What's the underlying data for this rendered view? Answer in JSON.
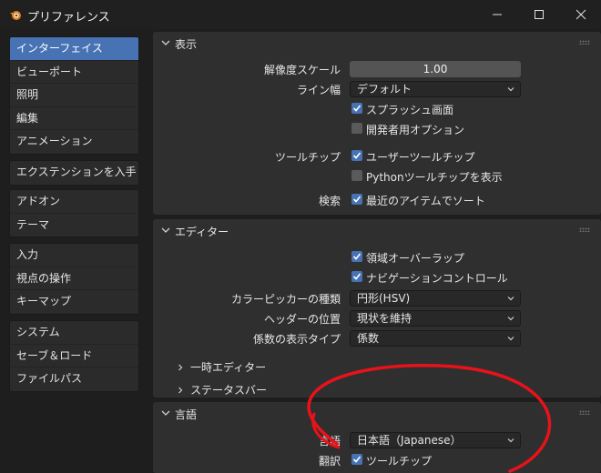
{
  "window": {
    "title": "プリファレンス",
    "controls": [
      "minimize-icon",
      "maximize-icon",
      "close-icon"
    ]
  },
  "sidebar": {
    "groups": [
      {
        "items": [
          {
            "label": "インターフェイス",
            "active": true
          },
          {
            "label": "ビューポート"
          },
          {
            "label": "照明"
          },
          {
            "label": "編集"
          },
          {
            "label": "アニメーション"
          }
        ]
      },
      {
        "items": [
          {
            "label": "エクステンションを入手"
          }
        ]
      },
      {
        "items": [
          {
            "label": "アドオン"
          },
          {
            "label": "テーマ"
          }
        ]
      },
      {
        "items": [
          {
            "label": "入力"
          },
          {
            "label": "視点の操作"
          },
          {
            "label": "キーマップ"
          }
        ]
      },
      {
        "items": [
          {
            "label": "システム"
          },
          {
            "label": "セーブ＆ロード"
          },
          {
            "label": "ファイルパス"
          }
        ]
      }
    ]
  },
  "display": {
    "title": "表示",
    "resolution_scale_label": "解像度スケール",
    "resolution_scale_value": "1.00",
    "line_width_label": "ライン幅",
    "line_width_value": "デフォルト",
    "splash_label": "スプラッシュ画面",
    "splash_checked": true,
    "dev_options_label": "開発者用オプション",
    "dev_options_checked": false,
    "tooltips_label": "ツールチップ",
    "user_tooltips_label": "ユーザーツールチップ",
    "user_tooltips_checked": true,
    "python_tooltips_label": "Pythonツールチップを表示",
    "python_tooltips_checked": false,
    "search_label": "検索",
    "sort_recent_label": "最近のアイテムでソート",
    "sort_recent_checked": true
  },
  "editors": {
    "title": "エディター",
    "region_overlap_label": "領域オーバーラップ",
    "region_overlap_checked": true,
    "nav_controls_label": "ナビゲーションコントロール",
    "nav_controls_checked": true,
    "color_picker_label": "カラーピッカーの種類",
    "color_picker_value": "円形(HSV)",
    "header_pos_label": "ヘッダーの位置",
    "header_pos_value": "現状を維持",
    "factor_type_label": "係数の表示タイプ",
    "factor_type_value": "係数",
    "temp_editors_label": "一時エディター",
    "status_bar_label": "ステータスバー"
  },
  "language": {
    "title": "言語",
    "language_label": "言語",
    "language_value": "日本語（Japanese）",
    "translate_label": "翻訳",
    "tooltips_label": "ツールチップ",
    "tooltips_checked": true
  },
  "colors": {
    "accent": "#4772b3",
    "annotation": "#e8121a"
  }
}
